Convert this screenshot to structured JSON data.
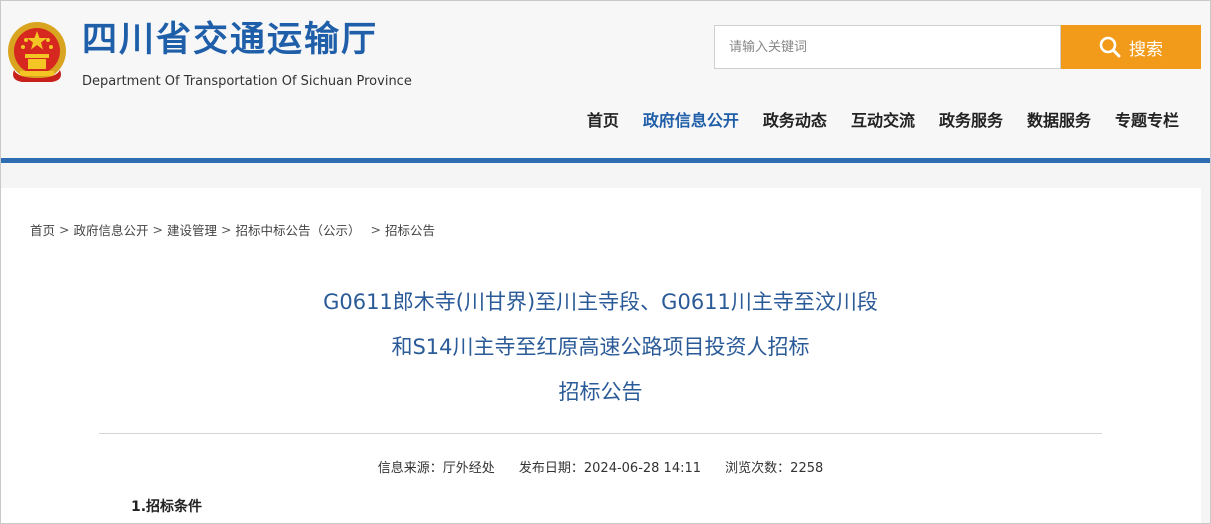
{
  "header": {
    "site_title": "四川省交通运输厅",
    "site_subtitle": "Department Of Transportation Of Sichuan Province",
    "search": {
      "placeholder": "请输入关键词",
      "button_label": "搜索"
    },
    "accent_color": "#1f5ea8",
    "search_button_color": "#f29b1a"
  },
  "nav": {
    "items": [
      {
        "label": "首页"
      },
      {
        "label": "政府信息公开",
        "active": true
      },
      {
        "label": "政务动态"
      },
      {
        "label": "互动交流"
      },
      {
        "label": "政务服务"
      },
      {
        "label": "数据服务"
      },
      {
        "label": "专题专栏"
      }
    ]
  },
  "breadcrumb": {
    "items": [
      "首页",
      "政府信息公开",
      "建设管理",
      "招标中标公告（公示）",
      "招标公告"
    ],
    "separator": ">"
  },
  "article": {
    "title_lines": [
      "G0611郎木寺(川甘界)至川主寺段、G0611川主寺至汶川段",
      "和S14川主寺至红原高速公路项目投资人招标",
      "招标公告"
    ],
    "source": "信息来源：厅外经处",
    "date": "发布日期：2024-06-28 14:11",
    "views": "浏览次数：2258",
    "first_section": "1.招标条件"
  }
}
